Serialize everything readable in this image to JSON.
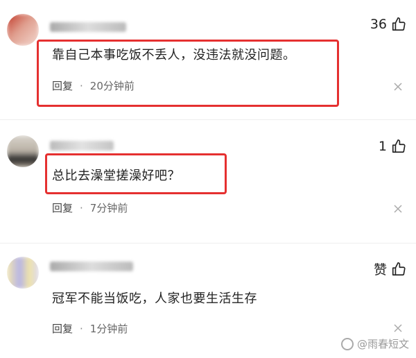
{
  "comments": [
    {
      "text": "靠自己本事吃饭不丢人，没违法就没问题。",
      "reply_label": "回复",
      "separator": "·",
      "time": "20分钟前",
      "likes": "36"
    },
    {
      "text": "总比去澡堂搓澡好吧？",
      "reply_label": "回复",
      "separator": "·",
      "time": "7分钟前",
      "likes": "1"
    },
    {
      "text": "冠军不能当饭吃，人家也要生活生存",
      "reply_label": "回复",
      "separator": "·",
      "time": "1分钟前",
      "likes": "赞"
    }
  ],
  "watermark": "@雨春短文",
  "colors": {
    "highlight": "#e53030",
    "text": "#222222",
    "meta": "#666666"
  },
  "icons": {
    "like": "thumbs-up-icon",
    "close": "close-icon"
  }
}
